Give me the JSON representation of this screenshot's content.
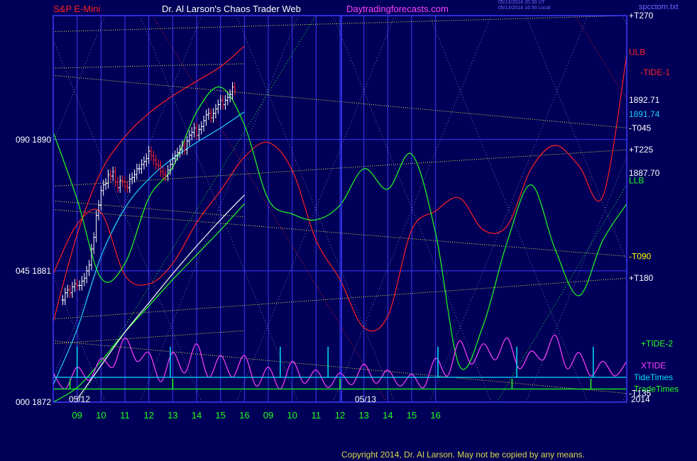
{
  "header": {
    "instrument": "S&P E-Mini",
    "title": "Dr. Al Larson's Chaos Trader Web",
    "site": "Daytradingforecasts.com",
    "stamp_line1": "05/13/2014 20:30 UT",
    "stamp_line2": "05/13/2014 16:30 Local",
    "filename": "spcctom.txt"
  },
  "copyright": "Copyright 2014, Dr. Al Larson. May not be copied by any means.",
  "colors": {
    "background": "#000058",
    "frame": "#3a3aff",
    "grid": "#3a3aff",
    "instrument": "#ff2020",
    "title": "#ffffff",
    "site": "#ff40ff",
    "electric_lines": "#e8e84a",
    "price_up": "#ffffff",
    "price_down": "#ff2020",
    "ulb": "#ff2020",
    "llb": "#20ff20",
    "tide1": "#ff2020",
    "tide2": "#20ff20",
    "xtide": "#ff40ff",
    "tidetimes": "#00e0ff",
    "tradetimes": "#20ff20",
    "moving_avg_fast": "#20d0ff",
    "moving_avg_slow": "#ffffff",
    "x_labels": "#20ff20"
  },
  "chart_data": {
    "type": "line",
    "x_unit": "hour",
    "days": [
      {
        "date": "05/12",
        "hours": [
          "09",
          "10",
          "11",
          "12",
          "13",
          "14",
          "15",
          "16"
        ]
      },
      {
        "date": "05/13",
        "hours": [
          "09",
          "10",
          "11",
          "12",
          "13",
          "14",
          "15",
          "16"
        ]
      }
    ],
    "ylim": [
      1872,
      1898.5
    ],
    "y_ticks": [
      {
        "label": "000  1872",
        "value": 1872
      },
      {
        "label": "045  1881",
        "value": 1881
      },
      {
        "label": "090  1890",
        "value": 1890
      }
    ],
    "bottom_right_label": "2014",
    "price_ohlc_series": {
      "name": "S&P E-Mini",
      "start_hour": 8.4,
      "step_hours": 0.1,
      "closes": [
        1879.0,
        1879.5,
        1879.7,
        1879.5,
        1879.9,
        1880.1,
        1880.0,
        1880.0,
        1880.3,
        1880.5,
        1881.0,
        1881.4,
        1882.5,
        1883.3,
        1884.8,
        1885.5,
        1886.5,
        1886.9,
        1887.0,
        1887.6,
        1887.5,
        1887.8,
        1887.1,
        1886.7,
        1887.2,
        1887.1,
        1886.8,
        1886.7,
        1887.3,
        1887.4,
        1887.6,
        1888.0,
        1888.0,
        1888.3,
        1888.5,
        1888.7,
        1889.2,
        1888.9,
        1888.6,
        1888.3,
        1888.2,
        1887.8,
        1887.6,
        1887.5,
        1887.9,
        1888.3,
        1888.7,
        1888.9,
        1889.1,
        1889.3,
        1889.6,
        1889.3,
        1889.9,
        1890.3,
        1890.5,
        1890.8,
        1890.3,
        1890.7,
        1890.9,
        1891.3,
        1891.7,
        1891.8,
        1891.5,
        1891.8,
        1892.1,
        1892.4,
        1892.7,
        1892.4,
        1892.7,
        1892.9,
        1893.1,
        1893.6,
        1893.4
      ]
    },
    "right_labels": [
      {
        "label": "+T270",
        "value": 1898.5,
        "color": "#ffffff"
      },
      {
        "label": "ULB",
        "value": 1896.0,
        "color": "#ff2020"
      },
      {
        "label": "-TIDE-1",
        "value": 1894.6,
        "color": "#ff2020"
      },
      {
        "label": "1892.71",
        "value": 1892.71,
        "color": "#ffffff"
      },
      {
        "label": "1891.74",
        "value": 1891.74,
        "color": "#20d0ff"
      },
      {
        "label": "-T045",
        "value": 1890.8,
        "color": "#ffffff"
      },
      {
        "label": "+T225",
        "value": 1889.3,
        "color": "#ffffff"
      },
      {
        "label": "1887.70",
        "value": 1887.7,
        "color": "#ffffff"
      },
      {
        "label": "LLB",
        "value": 1887.2,
        "color": "#20ff20"
      },
      {
        "label": "-T090",
        "value": 1882.0,
        "color": "#ffff00"
      },
      {
        "label": "+T180",
        "value": 1880.5,
        "color": "#ffffff"
      },
      {
        "label": "+TIDE-2",
        "value": 1876.0,
        "color": "#20ff20"
      },
      {
        "label": "XTIDE",
        "value": 1874.5,
        "color": "#ff40ff"
      },
      {
        "label": "TideTimes",
        "value": 1873.7,
        "color": "#00e0ff"
      },
      {
        "label": "TradeTimes",
        "value": 1872.9,
        "color": "#20ff20"
      },
      {
        "label": "-T135",
        "value": 1872.6,
        "color": "#ffffff"
      }
    ],
    "electric_lines": [
      {
        "name": "+T270",
        "points": [
          [
            8.0,
            1897.4
          ],
          [
            32.0,
            1898.5
          ]
        ]
      },
      {
        "name": "-T045",
        "points": [
          [
            8.0,
            1894.4
          ],
          [
            32.0,
            1890.8
          ]
        ]
      },
      {
        "name": "+T225",
        "points": [
          [
            8.0,
            1886.8
          ],
          [
            32.0,
            1889.3
          ]
        ]
      },
      {
        "name": "-T090",
        "points": [
          [
            8.0,
            1885.2
          ],
          [
            32.0,
            1882.0
          ]
        ]
      },
      {
        "name": "+T180",
        "points": [
          [
            8.0,
            1877.7
          ],
          [
            32.0,
            1880.5
          ]
        ]
      },
      {
        "name": "-T135",
        "points": [
          [
            8.0,
            1876.2
          ],
          [
            32.0,
            1872.6
          ]
        ]
      },
      {
        "name": "upper-left",
        "points": [
          [
            8.0,
            1894.9
          ],
          [
            16.0,
            1895.2
          ]
        ]
      },
      {
        "name": "mid-left",
        "points": [
          [
            8.0,
            1885.8
          ],
          [
            16.0,
            1884.7
          ]
        ]
      },
      {
        "name": "low-left",
        "points": [
          [
            8.0,
            1876.0
          ],
          [
            16.0,
            1876.9
          ]
        ]
      }
    ],
    "series": [
      {
        "name": "ULB",
        "x": [
          8.0,
          9.0,
          10.0,
          11.0,
          12.0,
          13.0,
          14.0,
          15.0,
          16.0
        ],
        "y": [
          1877.5,
          1883.5,
          1887.8,
          1890.2,
          1891.8,
          1893.0,
          1894.0,
          1895.0,
          1896.4
        ]
      },
      {
        "name": "LLB",
        "x": [
          8.0,
          9.0,
          10.0,
          11.0,
          12.0,
          13.0,
          14.0,
          15.0,
          16.0
        ],
        "y": [
          1872.0,
          1873.0,
          1874.8,
          1876.8,
          1878.6,
          1880.4,
          1882.1,
          1883.8,
          1885.6
        ]
      },
      {
        "name": "moving-average-fast",
        "x": [
          8.0,
          9.0,
          10.0,
          11.0,
          12.0,
          13.0,
          14.0,
          15.0,
          16.0
        ],
        "y": [
          1873.2,
          1877.0,
          1882.0,
          1885.3,
          1887.3,
          1888.7,
          1889.8,
          1890.8,
          1891.9
        ]
      },
      {
        "name": "moving-average-slow",
        "x": [
          9.0,
          10.0,
          11.0,
          12.0,
          13.0,
          14.0,
          15.0,
          16.0
        ],
        "y": [
          1872.2,
          1874.5,
          1876.8,
          1878.8,
          1880.8,
          1882.7,
          1884.5,
          1886.2
        ]
      },
      {
        "name": "TIDE-1",
        "x": [
          8.0,
          9.0,
          10.0,
          11.0,
          12.0,
          13.0,
          14.0,
          15.0,
          16.0,
          17.0,
          18.0,
          19.0,
          20.0,
          21.0,
          22.0,
          23.0,
          24.0,
          25.0,
          26.0,
          27.0,
          28.0,
          29.0,
          30.0,
          31.0,
          32.0
        ],
        "y": [
          1880.8,
          1884.2,
          1885.0,
          1880.7,
          1880.1,
          1881.5,
          1884.3,
          1886.5,
          1888.8,
          1889.8,
          1887.9,
          1883.1,
          1880.4,
          1877.1,
          1877.9,
          1883.8,
          1885.1,
          1886.0,
          1883.8,
          1884.1,
          1888.0,
          1889.6,
          1888.2,
          1886.1,
          1895.8
        ]
      },
      {
        "name": "TIDE-2",
        "x": [
          8.0,
          9.0,
          10.0,
          11.0,
          12.0,
          13.0,
          14.0,
          15.0,
          16.0,
          17.0,
          18.0,
          19.0,
          20.0,
          21.0,
          22.0,
          23.0,
          24.0,
          25.0,
          26.0,
          27.0,
          28.0,
          29.0,
          30.0,
          31.0,
          32.0
        ],
        "y": [
          1890.5,
          1885.9,
          1880.5,
          1881.5,
          1886.0,
          1888.1,
          1891.9,
          1893.6,
          1891.0,
          1885.9,
          1884.9,
          1884.5,
          1885.5,
          1888.0,
          1886.6,
          1889.0,
          1883.6,
          1874.5,
          1877.3,
          1883.0,
          1886.9,
          1882.5,
          1879.3,
          1883.1,
          1885.6
        ]
      },
      {
        "name": "XTIDE",
        "x": [
          8.0,
          8.5,
          9.0,
          9.5,
          10.0,
          10.5,
          11.0,
          11.5,
          12.0,
          12.5,
          13.0,
          13.5,
          14.0,
          14.5,
          15.0,
          15.5,
          16.0,
          16.5,
          17.0,
          17.5,
          18.0,
          18.5,
          19.0,
          19.5,
          20.0,
          20.5,
          21.0,
          21.5,
          22.0,
          22.5,
          23.0,
          23.5,
          24.0,
          24.5,
          25.0,
          25.5,
          26.0,
          26.5,
          27.0,
          27.5,
          28.0,
          28.5,
          29.0,
          29.5,
          30.0,
          30.5,
          31.0,
          31.5,
          32.0
        ],
        "y": [
          1874.0,
          1872.9,
          1874.4,
          1873.5,
          1875.0,
          1874.4,
          1876.4,
          1874.8,
          1875.4,
          1873.4,
          1875.4,
          1874.0,
          1876.0,
          1873.7,
          1875.2,
          1873.7,
          1875.2,
          1873.1,
          1874.4,
          1872.9,
          1874.8,
          1873.3,
          1874.2,
          1873.0,
          1874.0,
          1873.2,
          1874.6,
          1873.3,
          1874.2,
          1873.1,
          1873.9,
          1873.0,
          1875.0,
          1873.8,
          1876.2,
          1874.6,
          1876.0,
          1874.9,
          1876.4,
          1874.3,
          1875.5,
          1874.9,
          1876.6,
          1874.3,
          1875.4,
          1873.8,
          1874.8,
          1873.8,
          1874.8
        ]
      },
      {
        "name": "TideTimes",
        "x": [
          8.0,
          32.0
        ],
        "y": [
          1873.7,
          1873.7
        ]
      },
      {
        "name": "TradeTimes",
        "x": [
          8.0,
          32.0
        ],
        "y": [
          1872.9,
          1872.9
        ]
      }
    ],
    "tide_times": [
      9.0,
      12.9,
      17.5,
      19.5,
      24.1,
      27.4,
      30.6
    ],
    "trade_times": [
      8.7,
      13.0,
      20.0,
      27.2,
      30.5
    ]
  }
}
